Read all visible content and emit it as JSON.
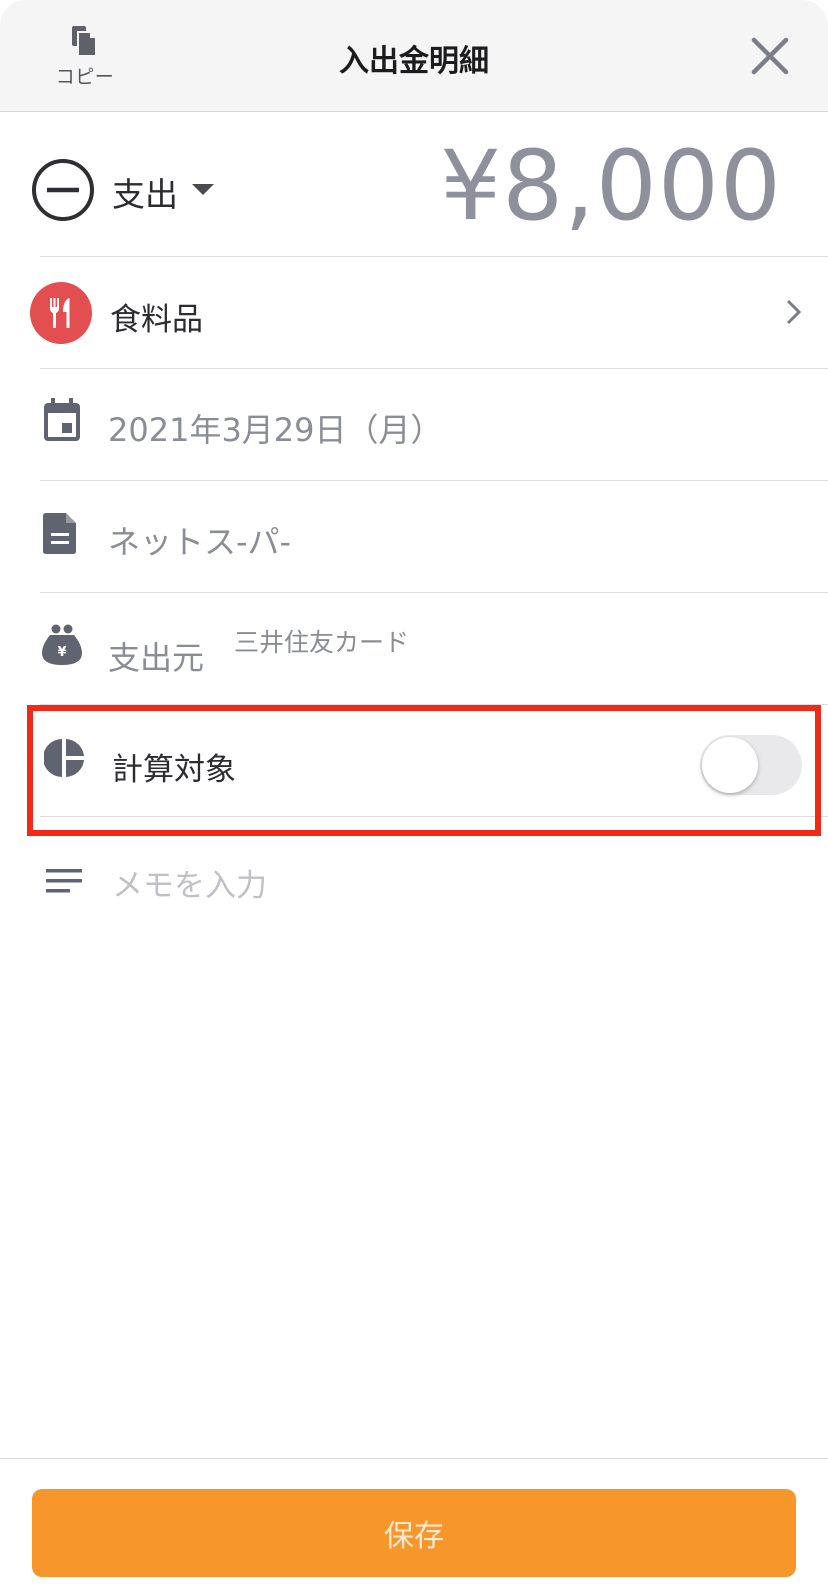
{
  "header": {
    "copy_label": "コピー",
    "title": "入出金明細",
    "close_icon": "close-icon",
    "copy_icon": "copy-icon"
  },
  "transaction": {
    "type_label": "支出",
    "amount": "¥8,000"
  },
  "category": {
    "label": "食料品",
    "icon": "fork-knife-icon",
    "icon_color": "#e34f51"
  },
  "date": {
    "label": "2021年3月29日（月）",
    "icon": "calendar-icon"
  },
  "name": {
    "label": "ネットス-パ-",
    "icon": "document-icon"
  },
  "source": {
    "label": "支出元",
    "value": "三井住友カード",
    "icon": "wallet-yen-icon"
  },
  "calculation": {
    "label": "計算対象",
    "enabled": false,
    "icon": "pie-chart-icon"
  },
  "memo": {
    "placeholder": "メモを入力",
    "icon": "lines-icon"
  },
  "footer": {
    "save_label": "保存",
    "save_color": "#f7962b"
  },
  "highlight_color": "#f12a17"
}
